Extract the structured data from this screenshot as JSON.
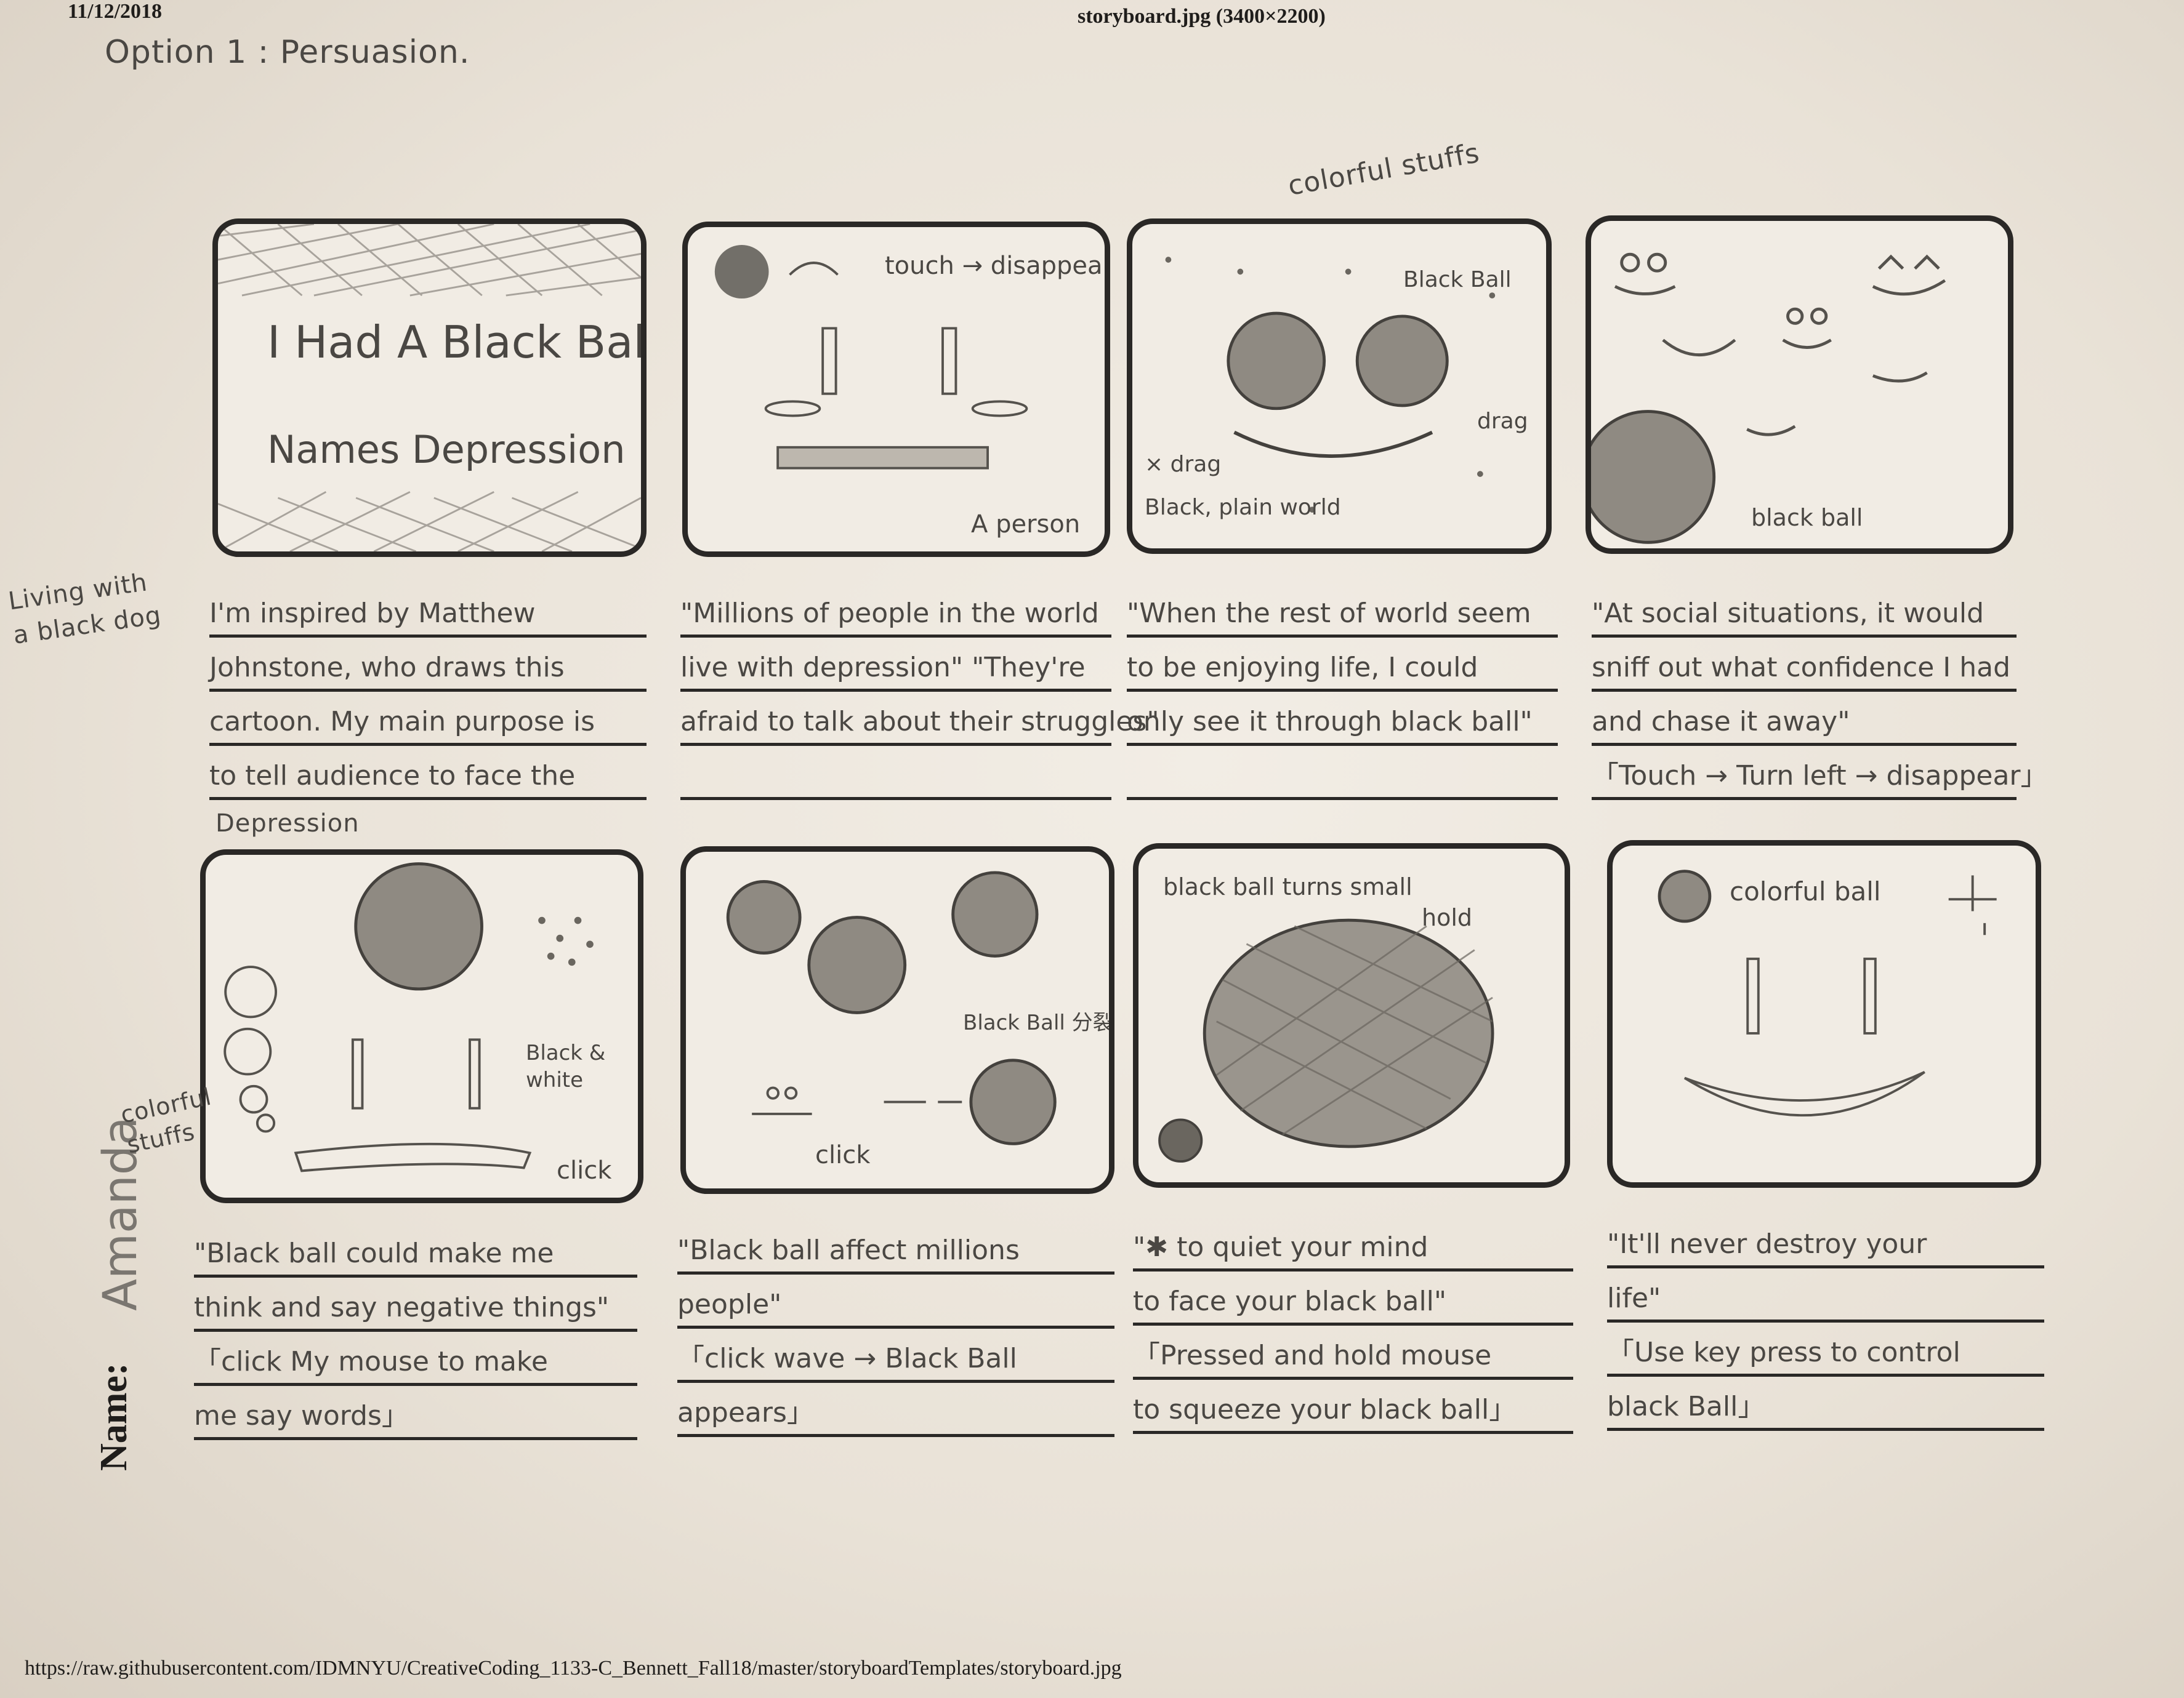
{
  "header": {
    "date": "11/12/2018",
    "file_label": "storyboard.jpg (3400×2200)",
    "url": "https://raw.githubusercontent.com/IDMNYU/CreativeCoding_1133-C_Bennett_Fall18/master/storyboardTemplates/storyboard.jpg"
  },
  "option_title": "Option 1 : Persuasion.",
  "side_note": [
    "Living with",
    "a black dog"
  ],
  "name": {
    "label": "Name:",
    "value": "Amanda"
  },
  "frames": [
    {
      "texts": [
        "I Had A Black Ball",
        "Names Depression"
      ]
    },
    {
      "texts": [
        "touch → disappear",
        "A person"
      ]
    },
    {
      "texts": [
        "colorful stuffs",
        "Black Ball",
        "drag",
        "× drag",
        "Black, plain world"
      ]
    },
    {
      "texts": [
        "black ball"
      ]
    },
    {
      "texts": [
        "colorful stuffs",
        "Black & white",
        "click"
      ]
    },
    {
      "texts": [
        "Black Ball 分裂",
        "click"
      ]
    },
    {
      "texts": [
        "black ball turns small",
        "hold"
      ]
    },
    {
      "texts": [
        "colorful ball"
      ]
    }
  ],
  "captions": [
    [
      "I'm inspired by Matthew",
      "Johnstone, who draws this",
      "cartoon. My main purpose is",
      "to tell audience to face the",
      "Depression"
    ],
    [
      "\"Millions of people in the world",
      "live with depression\" \"They're",
      "afraid to talk about their struggles\"",
      ""
    ],
    [
      "\"When the rest of world seem",
      "to be enjoying life, I could",
      "only see it through black ball\"",
      ""
    ],
    [
      "\"At social situations, it would",
      "sniff out what confidence I had",
      "and chase it away\"",
      "「Touch → Turn left → disappear」"
    ],
    [
      "\"Black ball could make me",
      "think and say negative things\"",
      "「click My mouse to make",
      "me say words」"
    ],
    [
      "\"Black ball affect millions",
      "people\"",
      "「click wave → Black Ball",
      "appears」"
    ],
    [
      "\"✱ to quiet your mind",
      "to face your black ball\"",
      "「Pressed and hold mouse",
      "to squeeze your black ball」"
    ],
    [
      "\"It'll never destroy your",
      "life\"",
      "「Use key press to control",
      "black Ball」"
    ]
  ]
}
